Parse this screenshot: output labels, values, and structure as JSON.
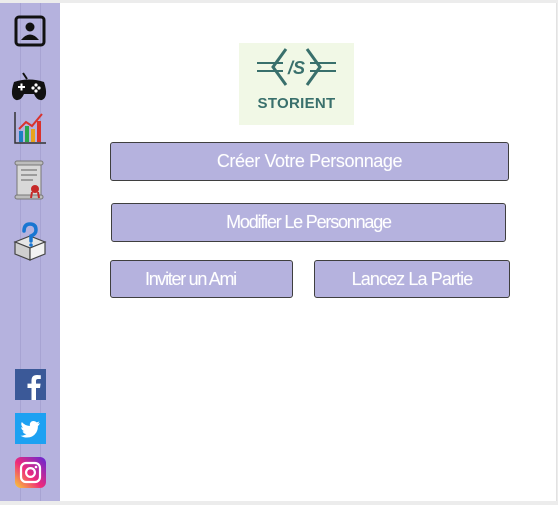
{
  "logo": {
    "symbol": "/S",
    "text": "STORIENT"
  },
  "sidebar": {
    "items": [
      {
        "name": "profile-icon"
      },
      {
        "name": "gamepad-icon"
      },
      {
        "name": "stats-chart-icon"
      },
      {
        "name": "certificate-scroll-icon"
      },
      {
        "name": "help-box-icon"
      }
    ],
    "social": [
      {
        "name": "facebook-icon",
        "color": "#3b5998"
      },
      {
        "name": "twitter-icon",
        "color": "#1da1f2"
      },
      {
        "name": "instagram-icon",
        "color": "#c13584"
      }
    ]
  },
  "buttons": {
    "create": "Créer Votre  Personnage",
    "modify": "Modifier Le Personnage",
    "invite": "Inviter un Ami",
    "launch": "Lancez La Partie"
  },
  "colors": {
    "accent": "#b5b2de",
    "logo_bg": "#f1f8e6",
    "logo_text": "#39706c"
  }
}
